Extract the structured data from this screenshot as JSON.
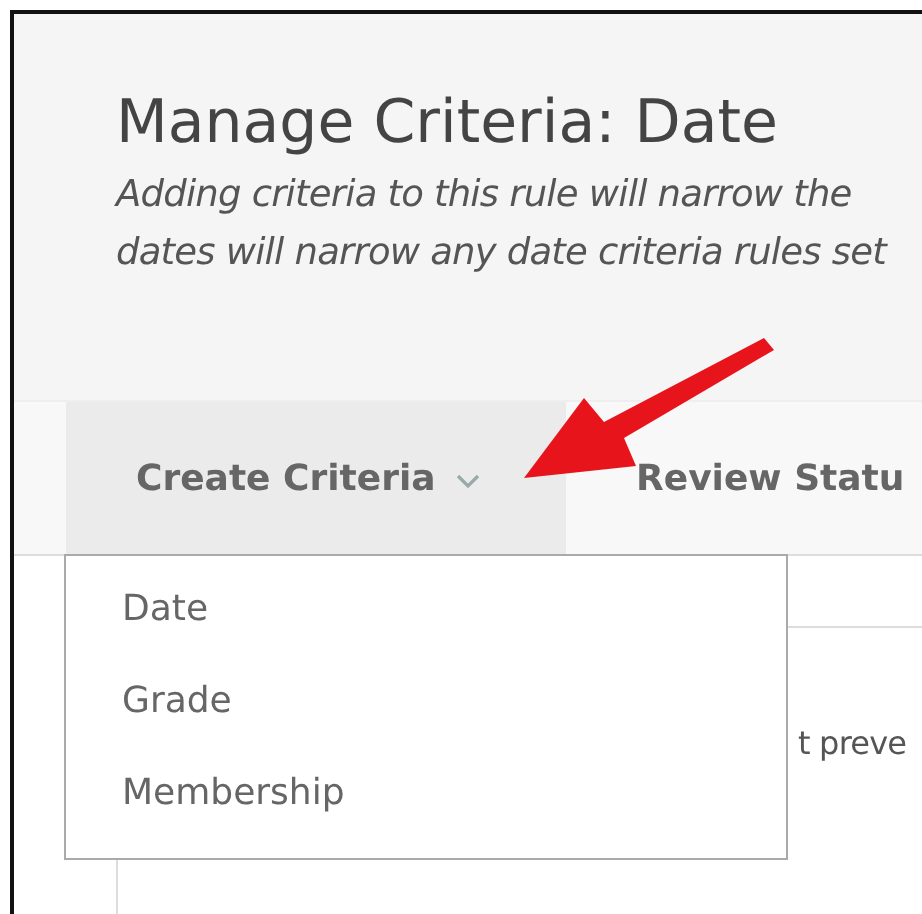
{
  "header": {
    "title": "Manage Criteria: Date",
    "description_lines": [
      "Adding criteria to this rule will narrow the",
      "dates will narrow any date criteria rules set"
    ]
  },
  "tabs": [
    {
      "label": "Create Criteria",
      "selected": true,
      "has_menu": true
    },
    {
      "label": "Review Statu",
      "selected": false,
      "has_menu": false
    }
  ],
  "menu": {
    "items": [
      "Date",
      "Grade",
      "Membership"
    ]
  },
  "content": {
    "partial_text": "t preve"
  }
}
